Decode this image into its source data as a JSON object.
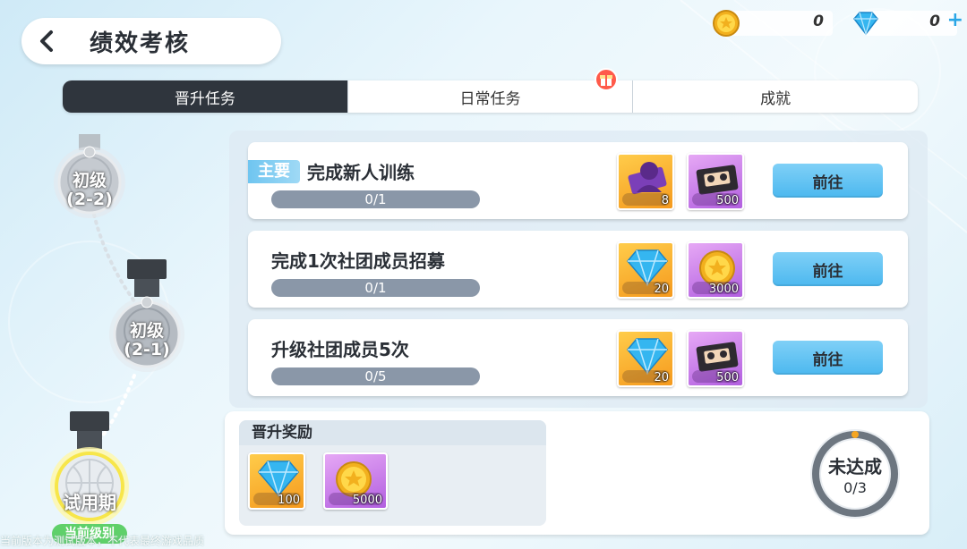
{
  "header": {
    "title": "绩效考核"
  },
  "currency": {
    "gold": "0",
    "diamond": "0",
    "add": "+"
  },
  "tabs": [
    {
      "label": "晋升任务",
      "active": true
    },
    {
      "label": "日常任务",
      "active": false,
      "badge": "gift-icon"
    },
    {
      "label": "成就",
      "active": false
    }
  ],
  "ranks": [
    {
      "label_line1": "初级",
      "label_line2": "(2-2)"
    },
    {
      "label_line1": "初级",
      "label_line2": "(2-1)"
    },
    {
      "label_line1": "试用期",
      "label_line2": "",
      "current_label": "当前级别"
    }
  ],
  "tasks": [
    {
      "tag": "主要",
      "title": "完成新人训练",
      "progress_text": "0/1",
      "progress": 0,
      "rewards": [
        {
          "icon": "character-card-icon",
          "qty": "8",
          "bg": "orange"
        },
        {
          "icon": "video-tape-icon",
          "qty": "500",
          "bg": "purple"
        }
      ],
      "button": "前往"
    },
    {
      "tag": "",
      "title": "完成1次社团成员招募",
      "progress_text": "0/1",
      "progress": 0,
      "rewards": [
        {
          "icon": "diamond-icon",
          "qty": "20",
          "bg": "orange"
        },
        {
          "icon": "gold-coin-icon",
          "qty": "3000",
          "bg": "purple"
        }
      ],
      "button": "前往"
    },
    {
      "tag": "",
      "title": "升级社团成员5次",
      "progress_text": "0/5",
      "progress": 0,
      "rewards": [
        {
          "icon": "diamond-icon",
          "qty": "20",
          "bg": "orange"
        },
        {
          "icon": "video-tape-icon",
          "qty": "500",
          "bg": "purple"
        }
      ],
      "button": "前往"
    }
  ],
  "promotion": {
    "heading": "晋升奖励",
    "rewards": [
      {
        "icon": "diamond-icon",
        "qty": "100"
      },
      {
        "icon": "gold-coin-icon",
        "qty": "5000"
      }
    ],
    "status": "未达成",
    "count": "0/3",
    "progress": 0
  },
  "footer_note": "当前版本为测试版本，不代表最终游戏品质",
  "colors": {
    "accent": "#4cb8ef",
    "tab_active": "#2f353d",
    "current_badge": "#5fd06a"
  }
}
